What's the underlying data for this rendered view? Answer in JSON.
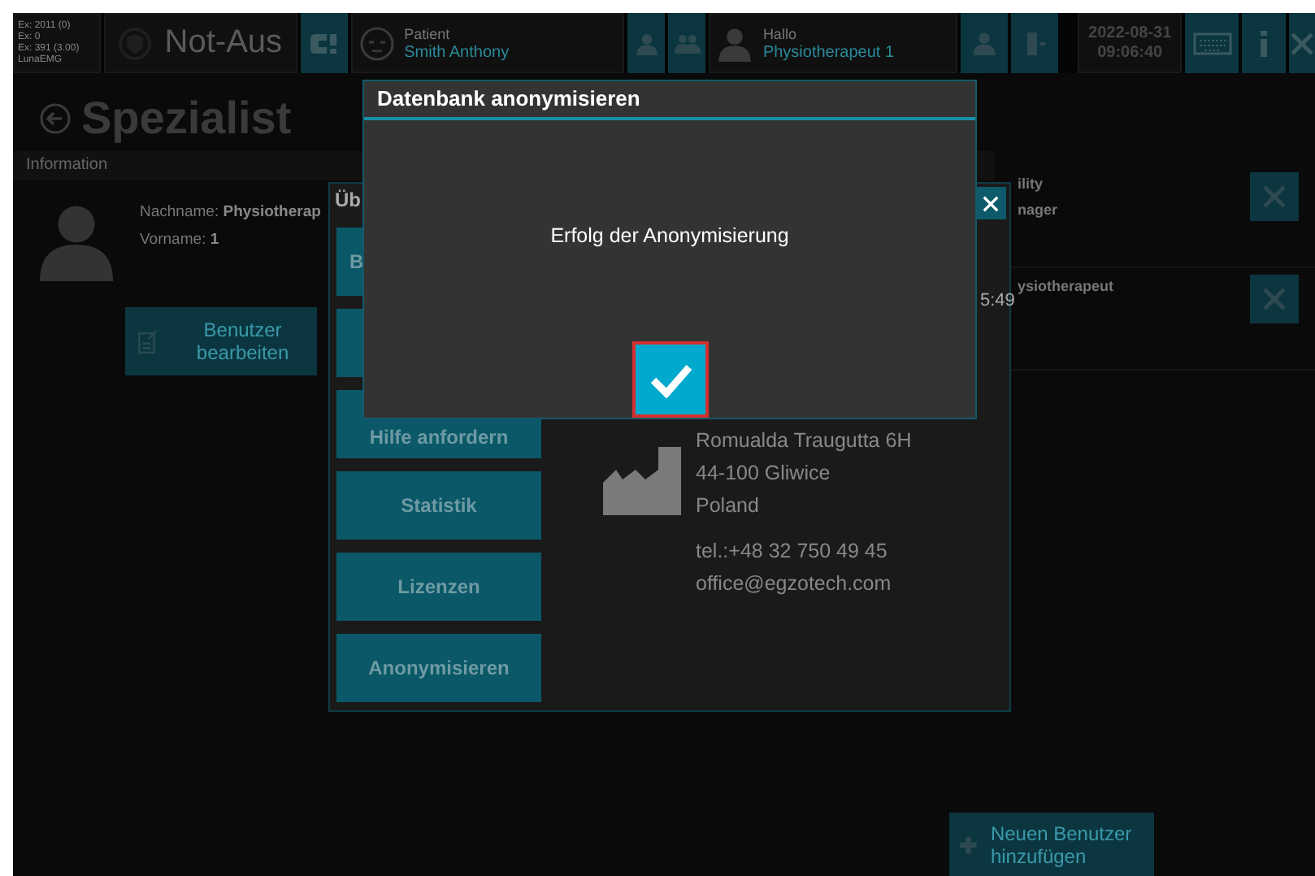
{
  "status_info": [
    "Ex: 2011 (0)",
    "Ex: 0",
    "Ex: 391 (3.00)",
    "LunaEMG"
  ],
  "emergency_stop": {
    "label": "Not-Aus"
  },
  "patient": {
    "label": "Patient",
    "name": "Smith Anthony"
  },
  "user": {
    "greeting": "Hallo",
    "name": "Physiotherapeut 1"
  },
  "datetime": {
    "date": "2022-08-31",
    "time": "09:06:40"
  },
  "page": {
    "title": "Spezialist",
    "section": "Information",
    "fields": [
      {
        "label": "Nachname:",
        "value": "Physiotherap"
      },
      {
        "label": "Vorname:",
        "value": "1"
      }
    ],
    "edit_button": "Benutzer bearbeiten"
  },
  "user_list": [
    {
      "lines": [
        "ility",
        "nager"
      ]
    },
    {
      "lines": [
        "ysiotherapeut"
      ]
    }
  ],
  "add_button": "Neuen Benutzer hinzufügen",
  "about_dialog": {
    "title": "Üb",
    "time_fragment": "5:49",
    "menu": [
      {
        "kind": "button",
        "label": "B"
      },
      {
        "kind": "blank"
      },
      {
        "kind": "button",
        "label": "Hilfe anfordern"
      },
      {
        "kind": "button",
        "label": "Statistik"
      },
      {
        "kind": "button",
        "label": "Lizenzen"
      },
      {
        "kind": "button",
        "label": "Anonymisieren"
      }
    ],
    "company_lines": [
      "Romualda Traugutta 6H",
      "44-100 Gliwice",
      "Poland"
    ],
    "contact_lines": [
      "tel.:+48 32 750 49 45",
      "office@egzotech.com"
    ]
  },
  "confirm_dialog": {
    "title": "Datenbank anonymisieren",
    "message": "Erfolg der Anonymisierung"
  }
}
